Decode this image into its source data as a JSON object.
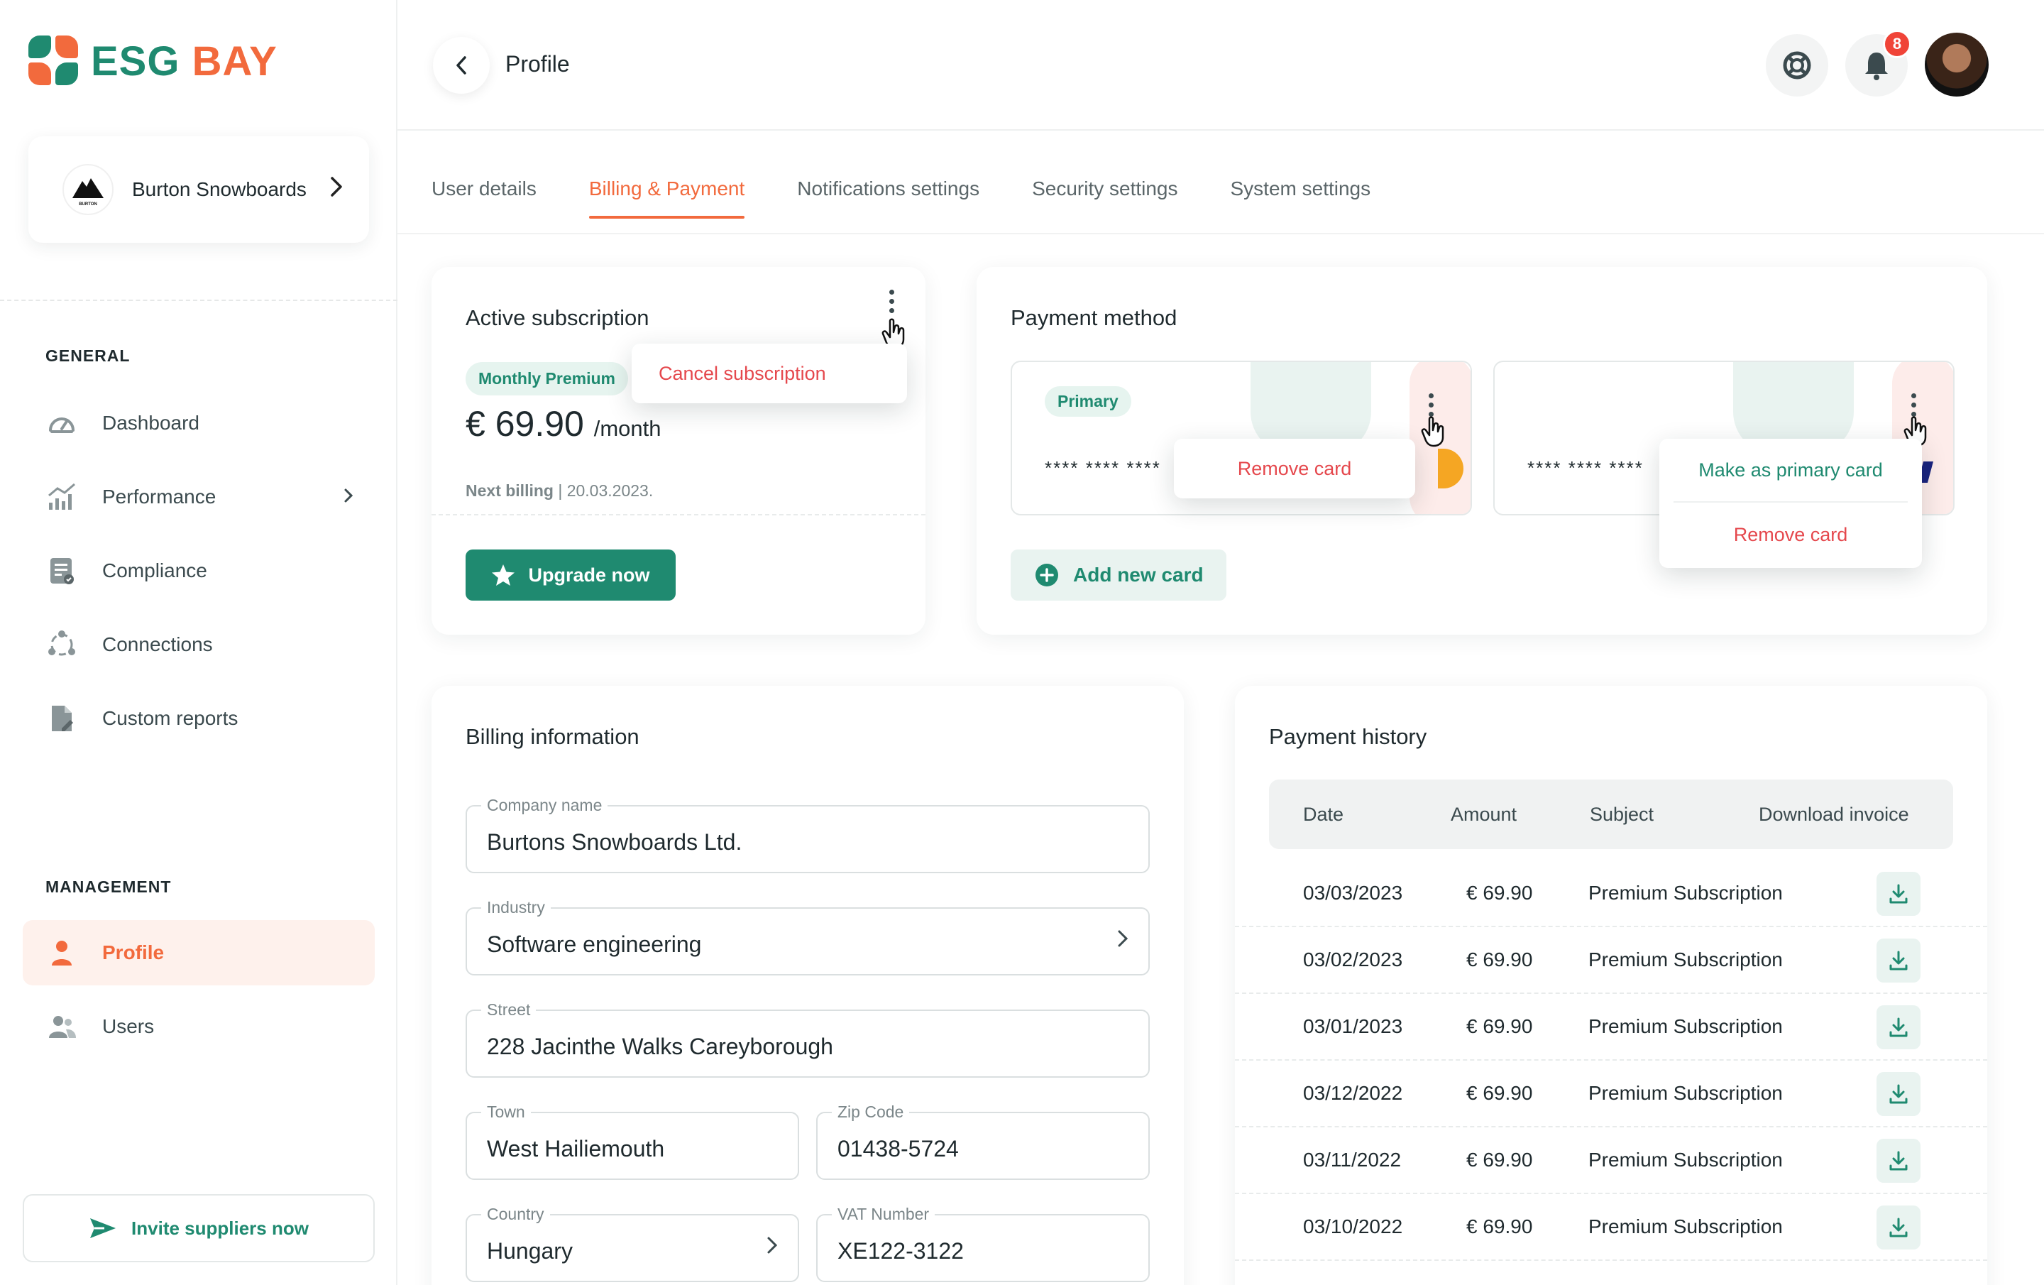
{
  "brand": {
    "part1": "ESG",
    "part2": "BAY"
  },
  "company": {
    "name": "Burton Snowboards",
    "logo_text": "BURTON"
  },
  "sidebar": {
    "general_label": "GENERAL",
    "general_items": [
      {
        "label": "Dashboard",
        "icon": "gauge-icon"
      },
      {
        "label": "Performance",
        "icon": "chart-icon"
      },
      {
        "label": "Compliance",
        "icon": "checklist-icon"
      },
      {
        "label": "Connections",
        "icon": "connections-icon"
      },
      {
        "label": "Custom reports",
        "icon": "report-icon"
      }
    ],
    "management_label": "MANAGEMENT",
    "management_items": [
      {
        "label": "Profile",
        "icon": "user-icon"
      },
      {
        "label": "Users",
        "icon": "users-icon"
      }
    ],
    "invite_label": "Invite suppliers now"
  },
  "header": {
    "title": "Profile",
    "notification_count": "8"
  },
  "tabs": [
    "User details",
    "Billing & Payment",
    "Notifications settings",
    "Security settings",
    "System settings"
  ],
  "subscription": {
    "title": "Active subscription",
    "plan": "Monthly Premium",
    "price": "€ 69.90",
    "period": "/month",
    "next_billing_label": "Next billing",
    "next_billing_date": " | 20.03.2023.",
    "upgrade_label": "Upgrade now",
    "menu_cancel": "Cancel subscription"
  },
  "payment_method": {
    "title": "Payment method",
    "primary_badge": "Primary",
    "card1_number": "**** **** ****",
    "card2_number": "**** **** ****",
    "card1_menu_remove": "Remove card",
    "card2_menu_primary": "Make as primary card",
    "card2_menu_remove": "Remove card",
    "add_card_label": "Add new card"
  },
  "billing": {
    "title": "Billing information",
    "company_label": "Company name",
    "company_value": "Burtons Snowboards Ltd.",
    "industry_label": "Industry",
    "industry_value": "Software engineering",
    "street_label": "Street",
    "street_value": "228 Jacinthe Walks Careyborough",
    "town_label": "Town",
    "town_value": "West Hailiemouth",
    "zip_label": "Zip Code",
    "zip_value": "01438-5724",
    "country_label": "Country",
    "country_value": "Hungary",
    "vat_label": "VAT Number",
    "vat_value": "XE122-3122"
  },
  "history": {
    "title": "Payment history",
    "columns": [
      "Date",
      "Amount",
      "Subject",
      "Download invoice"
    ],
    "rows": [
      {
        "date": "03/03/2023",
        "amount": "€ 69.90",
        "subject": "Premium Subscription"
      },
      {
        "date": "03/02/2023",
        "amount": "€ 69.90",
        "subject": "Premium Subscription"
      },
      {
        "date": "03/01/2023",
        "amount": "€ 69.90",
        "subject": "Premium Subscription"
      },
      {
        "date": "03/12/2022",
        "amount": "€ 69.90",
        "subject": "Premium Subscription"
      },
      {
        "date": "03/11/2022",
        "amount": "€ 69.90",
        "subject": "Premium Subscription"
      },
      {
        "date": "03/10/2022",
        "amount": "€ 69.90",
        "subject": "Premium Subscription"
      }
    ]
  },
  "colors": {
    "brand_green": "#1f8a70",
    "brand_orange": "#f26a3d",
    "danger": "#e5484d"
  }
}
